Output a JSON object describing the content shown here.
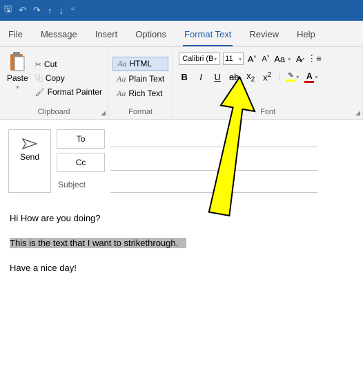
{
  "titlebar": {
    "save": "🖫",
    "undo": "↶",
    "redo": "↷",
    "up": "↑",
    "down": "↓",
    "more": "⁼"
  },
  "tabs": {
    "file": "File",
    "message": "Message",
    "insert": "Insert",
    "options": "Options",
    "format_text": "Format Text",
    "review": "Review",
    "help": "Help"
  },
  "ribbon": {
    "clipboard": {
      "paste": "Paste",
      "cut": "Cut",
      "copy": "Copy",
      "format_painter": "Format Painter",
      "label": "Clipboard"
    },
    "format": {
      "html": "HTML",
      "plain": "Plain Text",
      "rich": "Rich Text",
      "aa": "Aa",
      "label": "Format"
    },
    "font": {
      "family": "Calibri (B",
      "size": "11",
      "grow": "A˄",
      "shrink": "A˅",
      "change_case": "Aa",
      "clear": "🙼",
      "bold": "B",
      "italic": "I",
      "underline": "U",
      "strike": "ab",
      "sub": "x",
      "sub2": "2",
      "sup": "x",
      "sup2": "2",
      "label": "Font"
    }
  },
  "compose": {
    "send": "Send",
    "to": "To",
    "cc": "Cc",
    "subject": "Subject"
  },
  "body": {
    "line1": "Hi How are you doing?",
    "line2": "This is the text that I want to strikethrough.",
    "line3": "Have a nice day!"
  }
}
